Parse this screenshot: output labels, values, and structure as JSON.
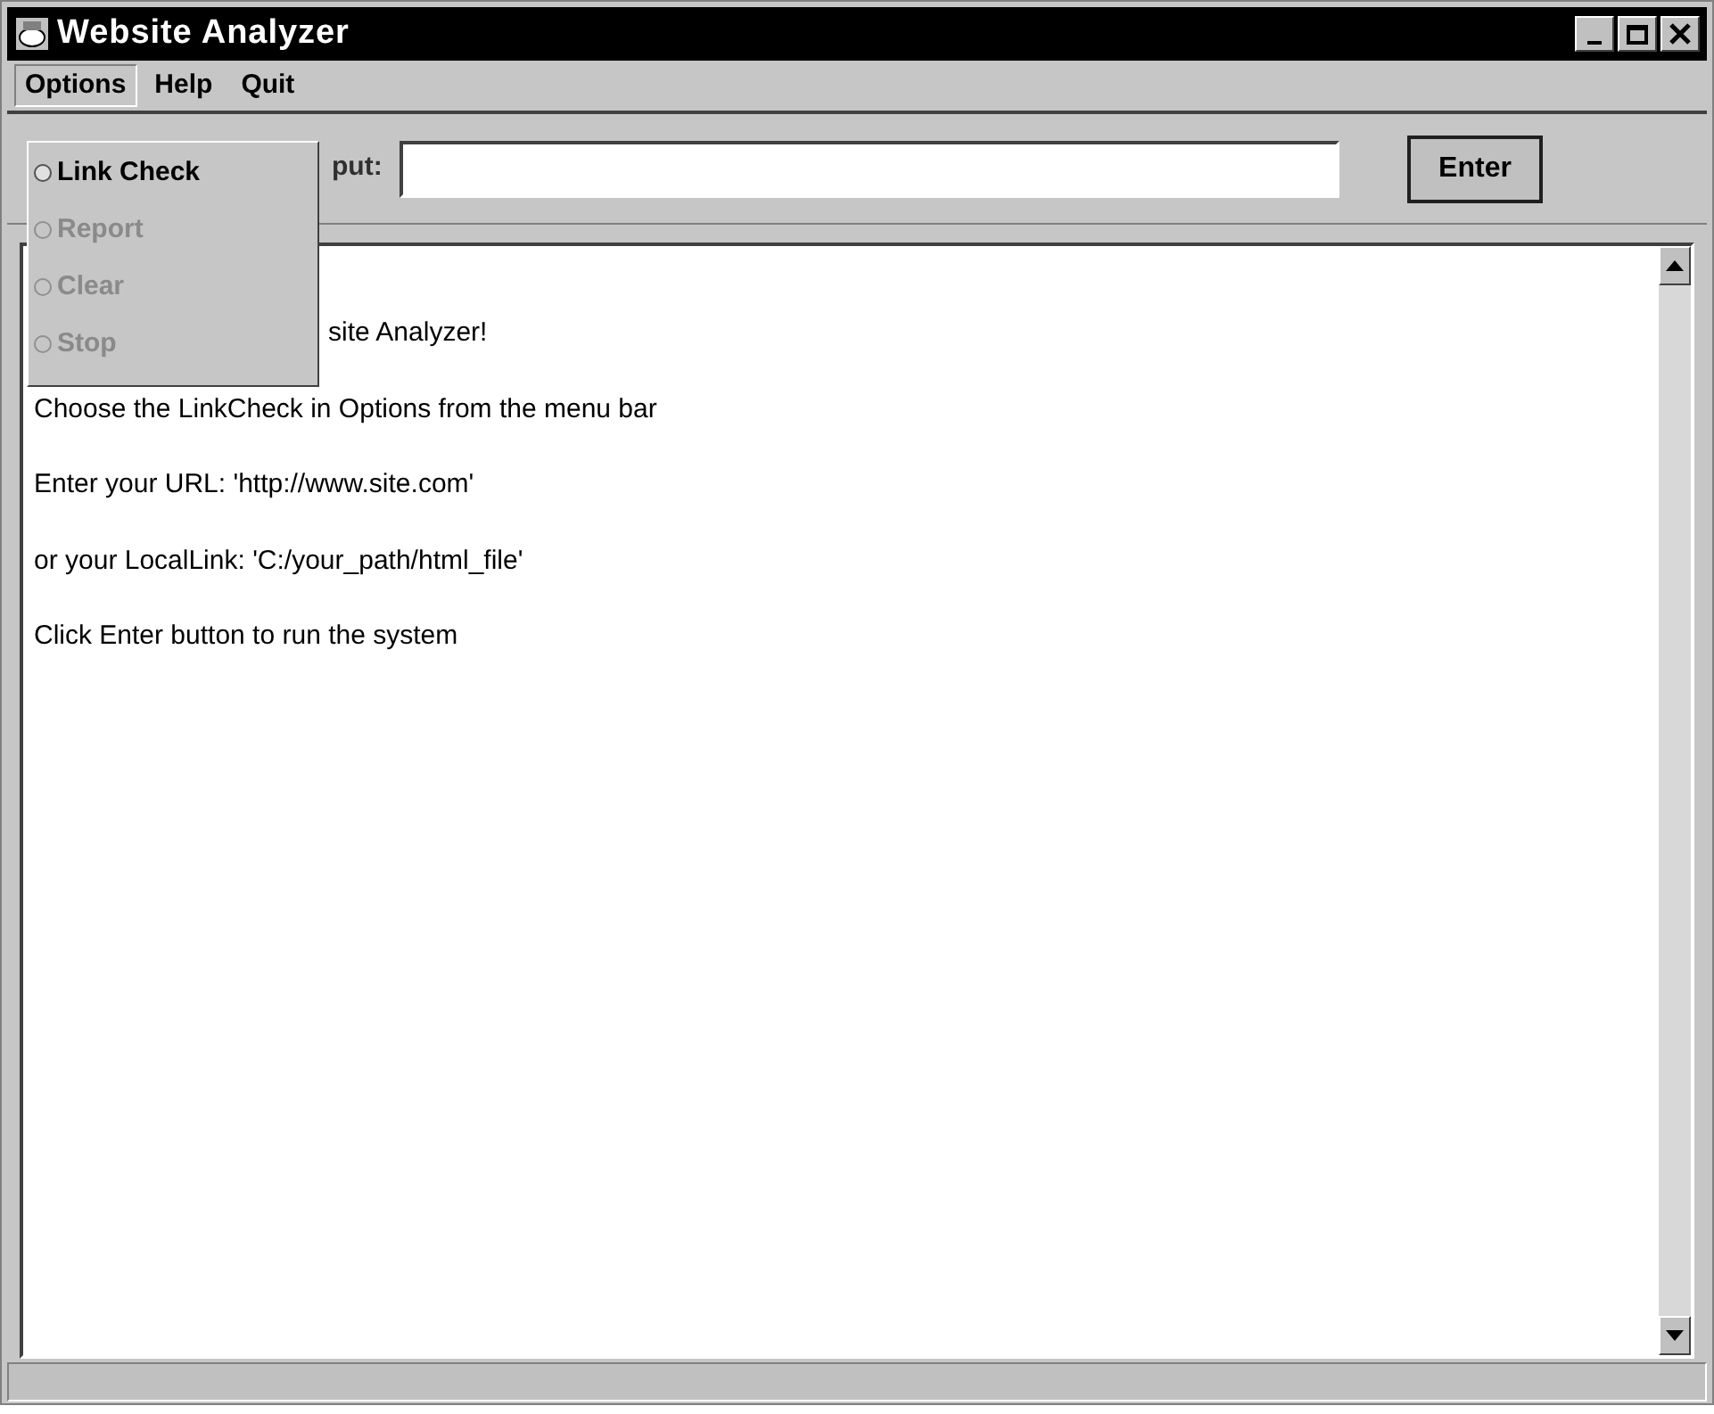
{
  "window": {
    "title": "Website Analyzer"
  },
  "menu_bar": [
    {
      "label": "Options",
      "selected": true
    },
    {
      "label": "Help",
      "selected": false
    },
    {
      "label": "Quit",
      "selected": false
    }
  ],
  "options_menu": [
    {
      "label": "Link Check",
      "disabled": false,
      "checked": false
    },
    {
      "label": "Report",
      "disabled": true,
      "checked": false
    },
    {
      "label": "Clear",
      "disabled": true,
      "checked": false
    },
    {
      "label": "Stop",
      "disabled": true,
      "checked": false
    }
  ],
  "input": {
    "label": "put:"
  },
  "enter_button": "Enter",
  "output_lines": [
    "site Analyzer!",
    "Choose the LinkCheck in Options from the menu bar",
    "Enter your URL: 'http://www.site.com'",
    "or your LocalLink: 'C:/your_path/html_file'",
    "Click Enter button to run the system"
  ]
}
